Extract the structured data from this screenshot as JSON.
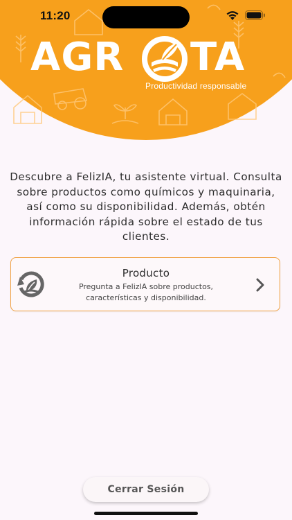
{
  "status_bar": {
    "time": "11:20"
  },
  "logo": {
    "text_left": "AGR",
    "text_right": "TA",
    "tagline": "Productividad responsable"
  },
  "description": "Descubre a FelizIA, tu asistente virtual. Consulta sobre productos como químicos y maquinaria, así como su disponibilidad. Además, obtén información rápida sobre el estado de tus clientes.",
  "product_card": {
    "title": "Producto",
    "subtitle": "Pregunta a FelizIA sobre productos, características y disponibilidad.",
    "icon": "leaf-recycle-icon"
  },
  "logout_button": {
    "label": "Cerrar Sesión"
  },
  "colors": {
    "brand_orange": "#F7A01C",
    "background": "#FCF6FB",
    "card_border": "#F0A040",
    "text": "#2c2c2c"
  }
}
